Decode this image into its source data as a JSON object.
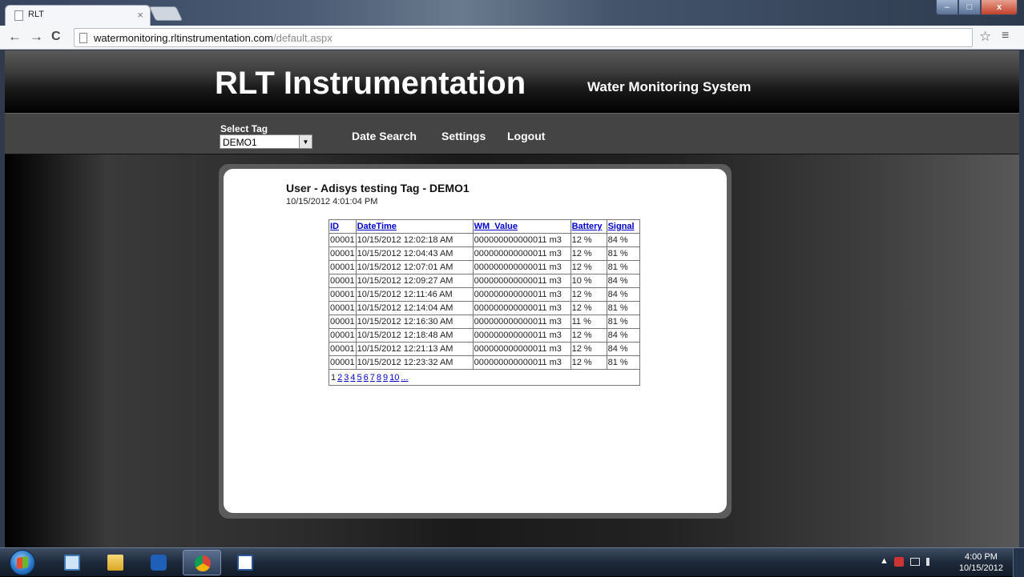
{
  "browser": {
    "tab_title": "RLT",
    "tab_close": "×",
    "url_host": "watermonitoring.rltinstrumentation.com",
    "url_path": "/default.aspx",
    "back": "←",
    "forward": "→",
    "reload": "C",
    "star": "☆",
    "menu": "≡",
    "win_minimize": "–",
    "win_maximize": "□",
    "win_close": "x"
  },
  "header": {
    "brand": "RLT Instrumentation",
    "subtitle": "Water Monitoring System"
  },
  "nav": {
    "select_label": "Select Tag",
    "select_value": "DEMO1",
    "links": [
      "Date Search",
      "Settings",
      "Logout"
    ]
  },
  "panel": {
    "title": "User - Adisys testing Tag - DEMO1",
    "timestamp": "10/15/2012 4:01:04 PM"
  },
  "table": {
    "headers": [
      "ID",
      "DateTime",
      "WM_Value",
      "Battery",
      "Signal"
    ],
    "rows": [
      [
        "00001",
        "10/15/2012 12:02:18 AM",
        "000000000000011 m3",
        "12 %",
        "84 %"
      ],
      [
        "00001",
        "10/15/2012 12:04:43 AM",
        "000000000000011 m3",
        "12 %",
        "81 %"
      ],
      [
        "00001",
        "10/15/2012 12:07:01 AM",
        "000000000000011 m3",
        "12 %",
        "81 %"
      ],
      [
        "00001",
        "10/15/2012 12:09:27 AM",
        "000000000000011 m3",
        "10 %",
        "84 %"
      ],
      [
        "00001",
        "10/15/2012 12:11:46 AM",
        "000000000000011 m3",
        "12 %",
        "84 %"
      ],
      [
        "00001",
        "10/15/2012 12:14:04 AM",
        "000000000000011 m3",
        "12 %",
        "81 %"
      ],
      [
        "00001",
        "10/15/2012 12:16:30 AM",
        "000000000000011 m3",
        "11 %",
        "81 %"
      ],
      [
        "00001",
        "10/15/2012 12:18:48 AM",
        "000000000000011 m3",
        "12 %",
        "84 %"
      ],
      [
        "00001",
        "10/15/2012 12:21:13 AM",
        "000000000000011 m3",
        "12 %",
        "84 %"
      ],
      [
        "00001",
        "10/15/2012 12:23:32 AM",
        "000000000000011 m3",
        "12 %",
        "81 %"
      ]
    ],
    "pager": {
      "current": "1",
      "pages": [
        "2",
        "3",
        "4",
        "5",
        "6",
        "7",
        "8",
        "9",
        "10",
        "..."
      ]
    }
  },
  "taskbar": {
    "apps": [
      "windows-explorer",
      "file-manager",
      "media-player",
      "chrome",
      "word"
    ],
    "active_app": "chrome",
    "tray_arrow": "▲",
    "clock_time": "4:00 PM",
    "clock_date": "10/15/2012"
  },
  "colors": {
    "link": "#0000cc",
    "header_bg": "#000000",
    "panel_bg": "#ffffff"
  }
}
